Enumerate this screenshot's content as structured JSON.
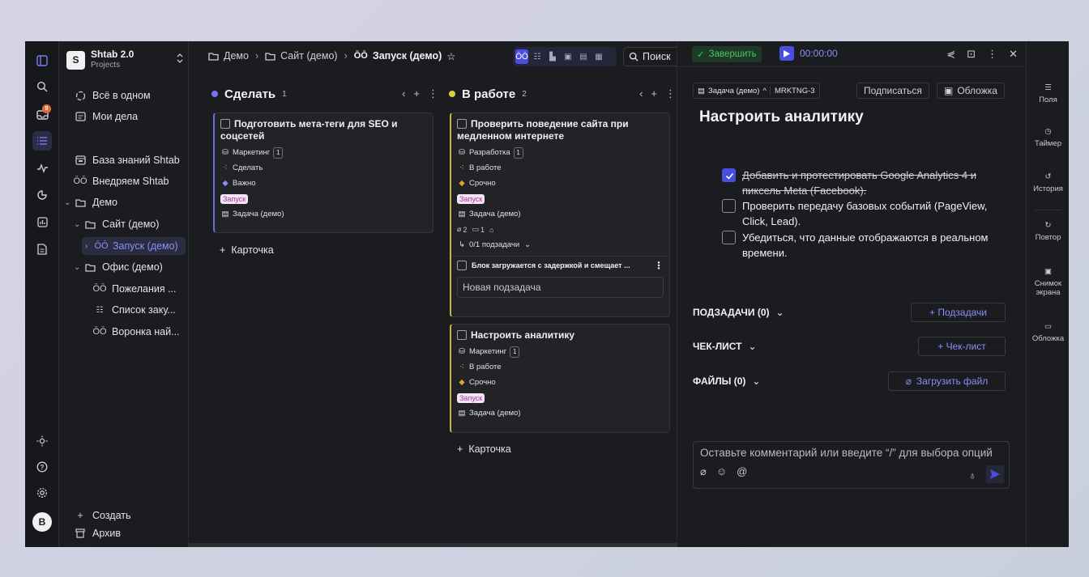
{
  "workspace": {
    "initial": "S",
    "name": "Shtab 2.0",
    "sub": "Projects"
  },
  "user": {
    "initial": "B"
  },
  "inbox": {
    "badge": "9"
  },
  "sidebar": {
    "all": "Всё в одном",
    "my": "Мои дела",
    "kb": "База знаний Shtab",
    "impl": "Внедряем Shtab",
    "demo": "Демо",
    "site": "Сайт (демо)",
    "launch": "Запуск (демо)",
    "office": "Офис (демо)",
    "wishes": "Пожелания ...",
    "purchases": "Список заку...",
    "funnel": "Воронка най...",
    "create": "Создать",
    "archive": "Архив"
  },
  "breadcrumb": {
    "a": "Демо",
    "b": "Сайт (демо)",
    "c": "Запуск (демо)"
  },
  "search": {
    "label": "Поиск"
  },
  "columns": {
    "todo": {
      "title": "Сделать",
      "count": "1",
      "color": "#7b6ef0"
    },
    "inwork": {
      "title": "В работе",
      "count": "2",
      "color": "#d9d23a"
    }
  },
  "cards": {
    "c1": {
      "title": "Подготовить мета-теги для SEO и соцсетей",
      "team": "Маркетинг",
      "team_n": "1",
      "status": "Сделать",
      "prio": "Важно",
      "tag": "Запуск",
      "type": "Задача (демо)"
    },
    "c2": {
      "title": "Проверить поведение сайта при медленном интернете",
      "team": "Разработка",
      "team_n": "1",
      "status": "В работе",
      "prio": "Срочно",
      "tag": "Запуск",
      "type": "Задача (демо)",
      "attach": "2",
      "comments": "1",
      "subtasks": "0/1 подзадачи",
      "sub1": "Блок загружается с задержкой и смещает ...",
      "newsub": "Новая подзадача"
    },
    "c3": {
      "title": "Настроить аналитику",
      "team": "Маркетинг",
      "team_n": "1",
      "status": "В работе",
      "prio": "Срочно",
      "tag": "Запуск",
      "type": "Задача (демо)"
    }
  },
  "addcard": "Карточка",
  "detail": {
    "complete": "Завершить",
    "timer": "00:00:00",
    "type": "Задача (демо)",
    "code": "MRKTNG-3",
    "subscribe": "Подписаться",
    "cover": "Обложка",
    "title": "Настроить аналитику",
    "checklist": [
      {
        "text": "Добавить и протестировать Google Analytics 4 и пиксель Meta (Facebook).",
        "done": true
      },
      {
        "text": "Проверить передачу базовых событий (PageView, Click, Lead).",
        "done": false
      },
      {
        "text": "Убедиться, что данные отображаются в реальном времени.",
        "done": false
      }
    ],
    "subtasks": "ПОДЗАДАЧИ (0)",
    "add_sub": "+ Подзадачи",
    "checklist_h": "ЧЕК-ЛИСТ",
    "add_check": "+ Чек-лист",
    "files": "ФАЙЛЫ (0)",
    "upload": "Загрузить файл",
    "comment_ph": "Оставьте комментарий или введите “/” для выбора опций"
  },
  "rpanel": {
    "fields": "Поля",
    "timer": "Таймер",
    "history": "История",
    "repeat": "Повтор",
    "screenshot": "Снимок экрана",
    "cover": "Обложка"
  }
}
